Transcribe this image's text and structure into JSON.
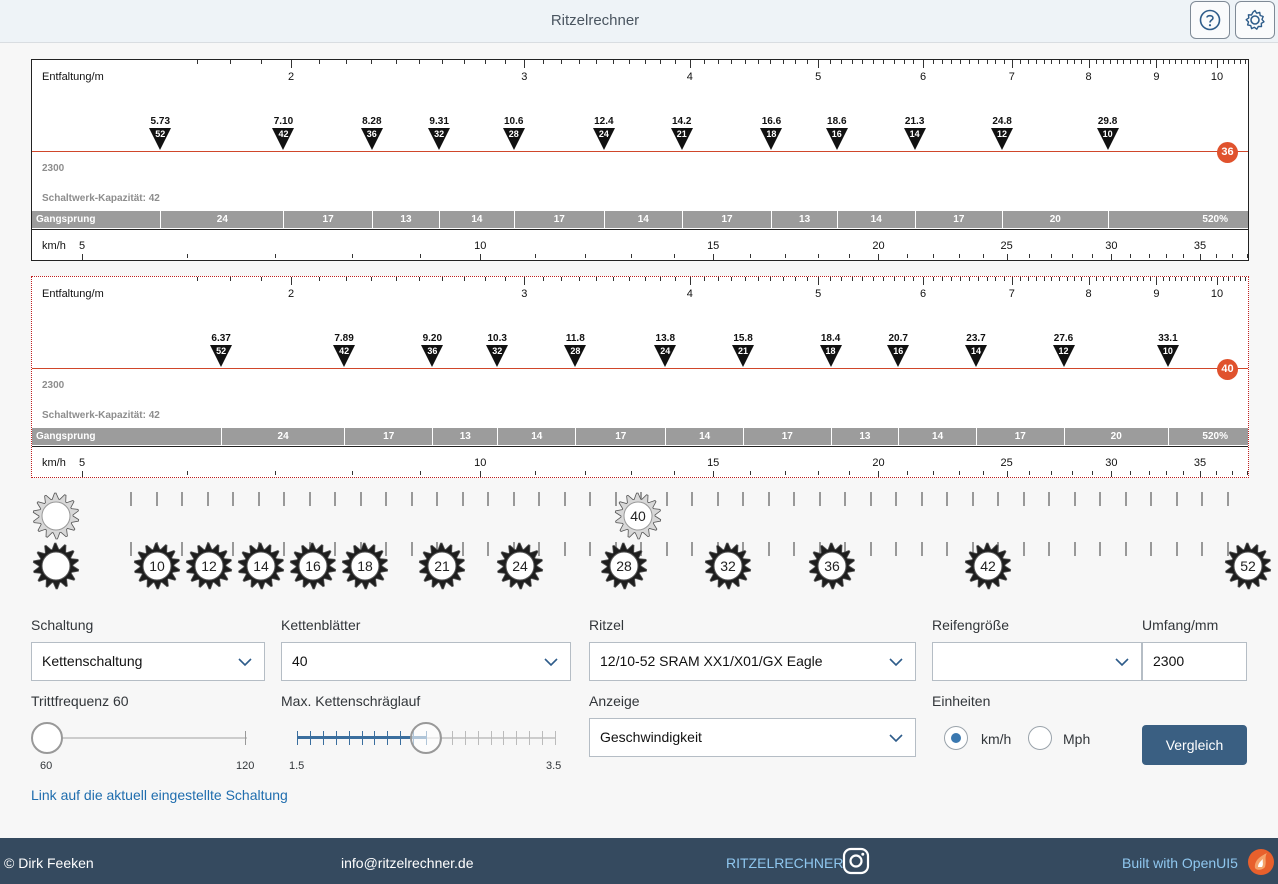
{
  "app": {
    "title": "Ritzelrechner"
  },
  "toolbar": {
    "help_icon": "help-icon",
    "settings_icon": "gear-icon"
  },
  "charts": [
    {
      "scale_label": "Entfaltung/m",
      "scale_ticks": [
        "2",
        "3",
        "4",
        "5",
        "6",
        "7",
        "8",
        "9",
        "10"
      ],
      "gears": [
        {
          "v": "5.73",
          "t": "52"
        },
        {
          "v": "7.10",
          "t": "42"
        },
        {
          "v": "8.28",
          "t": "36"
        },
        {
          "v": "9.31",
          "t": "32"
        },
        {
          "v": "10.6",
          "t": "28"
        },
        {
          "v": "12.4",
          "t": "24"
        },
        {
          "v": "14.2",
          "t": "21"
        },
        {
          "v": "16.6",
          "t": "18"
        },
        {
          "v": "18.6",
          "t": "16"
        },
        {
          "v": "21.3",
          "t": "14"
        },
        {
          "v": "24.8",
          "t": "12"
        },
        {
          "v": "29.8",
          "t": "10"
        }
      ],
      "chainring_badge": "36",
      "circumference": "2300",
      "capacity": "Schaltwerk-Kapazität: 42",
      "jump_label": "Gangsprung",
      "jumps": [
        "24",
        "17",
        "13",
        "14",
        "17",
        "14",
        "17",
        "13",
        "14",
        "17",
        "20"
      ],
      "range": "520%",
      "speed_label": "km/h",
      "speed_ticks": [
        "5",
        "10",
        "15",
        "20",
        "25",
        "30",
        "35"
      ]
    },
    {
      "scale_label": "Entfaltung/m",
      "scale_ticks": [
        "2",
        "3",
        "4",
        "5",
        "6",
        "7",
        "8",
        "9",
        "10"
      ],
      "gears": [
        {
          "v": "6.37",
          "t": "52"
        },
        {
          "v": "7.89",
          "t": "42"
        },
        {
          "v": "9.20",
          "t": "36"
        },
        {
          "v": "10.3",
          "t": "32"
        },
        {
          "v": "11.8",
          "t": "28"
        },
        {
          "v": "13.8",
          "t": "24"
        },
        {
          "v": "15.8",
          "t": "21"
        },
        {
          "v": "18.4",
          "t": "18"
        },
        {
          "v": "20.7",
          "t": "16"
        },
        {
          "v": "23.7",
          "t": "14"
        },
        {
          "v": "27.6",
          "t": "12"
        },
        {
          "v": "33.1",
          "t": "10"
        }
      ],
      "chainring_badge": "40",
      "circumference": "2300",
      "capacity": "Schaltwerk-Kapazität: 42",
      "jump_label": "Gangsprung",
      "jumps": [
        "24",
        "17",
        "13",
        "14",
        "17",
        "14",
        "17",
        "13",
        "14",
        "17",
        "20"
      ],
      "range": "520%",
      "speed_label": "km/h",
      "speed_ticks": [
        "5",
        "10",
        "15",
        "20",
        "25",
        "30",
        "35"
      ]
    }
  ],
  "chainring_selected": "40",
  "cogs": [
    "10",
    "12",
    "14",
    "16",
    "18",
    "21",
    "24",
    "28",
    "32",
    "36",
    "42",
    "52"
  ],
  "form": {
    "schaltung_label": "Schaltung",
    "schaltung_value": "Kettenschaltung",
    "kettenblaetter_label": "Kettenblätter",
    "kettenblaetter_value": "40",
    "ritzel_label": "Ritzel",
    "ritzel_value": "12/10-52 SRAM XX1/X01/GX Eagle",
    "reifen_label": "Reifengröße",
    "reifen_value": "",
    "umfang_label": "Umfang/mm",
    "umfang_value": "2300",
    "cadence_label": "Trittfrequenz 60",
    "cadence_min": "60",
    "cadence_max": "120",
    "cadence_value": 60,
    "cross_label": "Max. Kettenschräglauf",
    "cross_min": "1.5",
    "cross_max": "3.5",
    "cross_value": 2.5,
    "anzeige_label": "Anzeige",
    "anzeige_value": "Geschwindigkeit",
    "einheiten_label": "Einheiten",
    "unit_kmh": "km/h",
    "unit_mph": "Mph",
    "unit_selected": "km/h",
    "compare_button": "Vergleich",
    "link_text": "Link auf die aktuell eingestellte Schaltung"
  },
  "footer": {
    "copyright": "© Dirk Feeken",
    "email": "info@ritzelrechner.de",
    "brand": "RITZELRECHNER",
    "built_with": "Built with OpenUI5"
  }
}
